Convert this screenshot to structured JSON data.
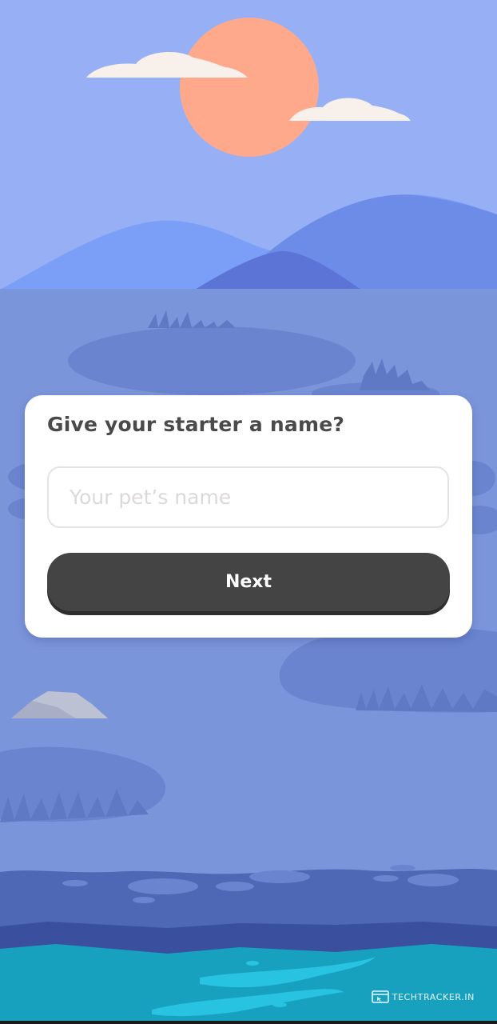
{
  "dialog": {
    "title": "Give your starter a name?",
    "name_input": {
      "placeholder": "Your pet’s name",
      "value": ""
    },
    "next_label": "Next"
  },
  "watermark": {
    "text": "TechTracker.in",
    "icon": "browser-window-icon"
  },
  "colors": {
    "sky": "#97aff4",
    "sun": "#ffa98c",
    "cloud": "#f8f0ea",
    "ground": "#7b95db",
    "water": "#17a1bf",
    "button": "#444444",
    "title_text": "#4a4a4a"
  }
}
